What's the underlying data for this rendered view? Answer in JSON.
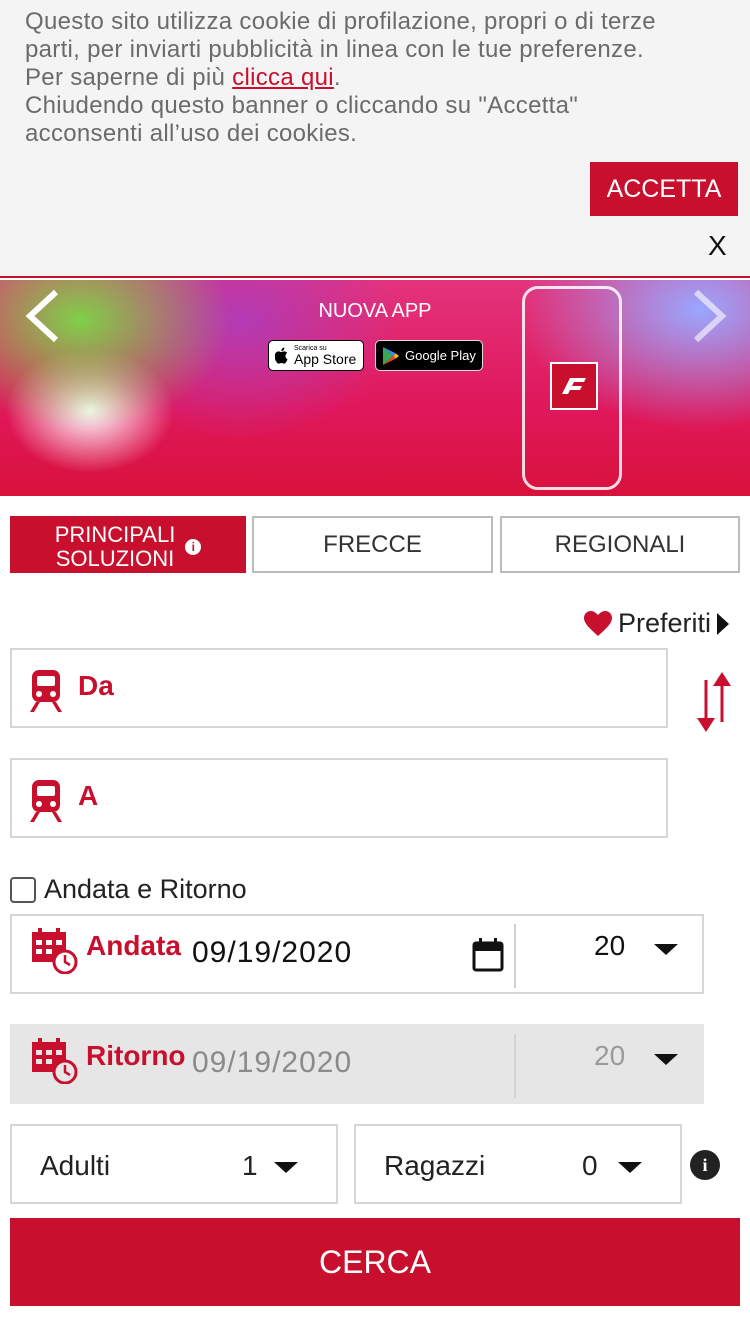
{
  "cookie_banner": {
    "line1": "Questo sito utilizza cookie di profilazione, propri o di terze",
    "line2": "parti, per inviarti pubblicità in linea con le tue preferenze.",
    "line3_prefix": "Per saperne di più ",
    "line3_link": "clicca qui",
    "line3_suffix": ".",
    "line4": "Chiudendo questo banner o cliccando su \"Accetta\"",
    "line5": "acconsenti all’uso dei cookies.",
    "accept_label": "ACCETTA",
    "close_label": "X"
  },
  "hero": {
    "title": "NUOVA APP",
    "app_store_small": "Scarica su",
    "app_store_label": "App Store",
    "google_play_label": "Google Play",
    "prev_icon": "chevron-left-icon",
    "next_icon": "chevron-right-icon"
  },
  "tabs": [
    {
      "line1": "PRINCIPALI",
      "line2": "SOLUZIONI",
      "active": true
    },
    {
      "label": "FRECCE",
      "active": false
    },
    {
      "label": "REGIONALI",
      "active": false
    }
  ],
  "favorites": {
    "label": "Preferiti"
  },
  "from_field": {
    "label": "Da"
  },
  "to_field": {
    "label": "A"
  },
  "round_trip": {
    "label": "Andata e Ritorno",
    "checked": false
  },
  "outbound": {
    "label": "Andata",
    "date": "09/19/2020",
    "hour": "20"
  },
  "return_trip": {
    "label": "Ritorno",
    "date": "09/19/2020",
    "hour": "20",
    "disabled": true
  },
  "passengers": {
    "adults_label": "Adulti",
    "adults_value": "1",
    "kids_label": "Ragazzi",
    "kids_value": "0"
  },
  "search_label": "CERCA",
  "colors": {
    "brand_red": "#c8102e",
    "banner_bg": "#f4f4f4",
    "disabled_bg": "#e6e6e6"
  }
}
